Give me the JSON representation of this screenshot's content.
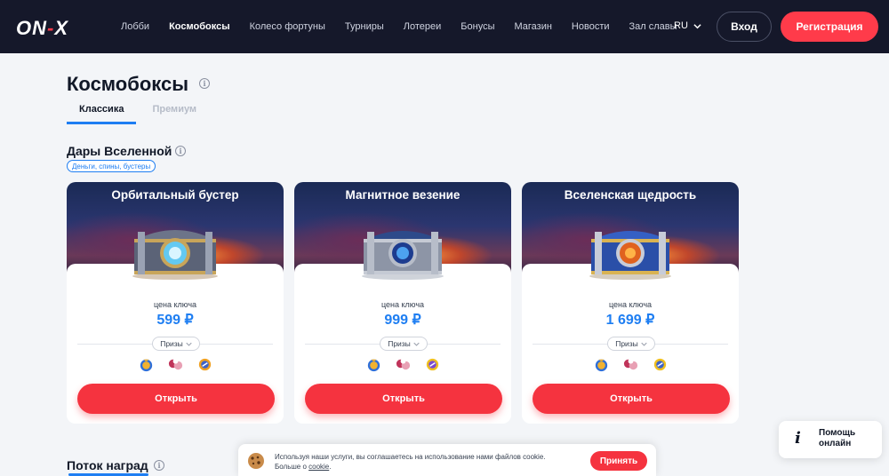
{
  "header": {
    "logo_main": "ON",
    "logo_dash": "-",
    "logo_x": "X",
    "nav": [
      "Лобби",
      "Космобоксы",
      "Колесо фортуны",
      "Турниры",
      "Лотереи",
      "Бонусы",
      "Магазин",
      "Новости",
      "Зал славы"
    ],
    "active_nav": "Космобоксы",
    "lang": "RU",
    "login_label": "Вход",
    "register_label": "Регистрация"
  },
  "page": {
    "title": "Космобоксы",
    "tabs": [
      {
        "label": "Классика",
        "active": true
      },
      {
        "label": "Премиум",
        "active": false
      }
    ]
  },
  "section": {
    "title": "Дары Вселенной",
    "badge": "Деньги, спины, бустеры"
  },
  "cards": [
    {
      "title": "Орбитальный бустер",
      "price_label": "цена ключа",
      "price": "599 ₽",
      "prizes_label": "Призы",
      "open_label": "Открыть",
      "chest_theme": "silver-glow"
    },
    {
      "title": "Магнитное везение",
      "price_label": "цена ключа",
      "price": "999 ₽",
      "prizes_label": "Призы",
      "open_label": "Открыть",
      "chest_theme": "steel-blue"
    },
    {
      "title": "Вселенская щедрость",
      "price_label": "цена ключа",
      "price": "1 699 ₽",
      "prizes_label": "Призы",
      "open_label": "Открыть",
      "chest_theme": "blue-vortex"
    }
  ],
  "next_section": {
    "title": "Поток наград"
  },
  "cookie": {
    "text": "Используя наши услуги, вы соглашаетесь на использование нами файлов cookie.",
    "more_prefix": "Больше о ",
    "link": "cookie",
    "more_suffix": ".",
    "accept_label": "Принять"
  },
  "help": {
    "label_line1": "Помощь",
    "label_line2": "онлайн"
  },
  "colors": {
    "header_bg": "#15182a",
    "accent_red": "#f5333f",
    "accent_blue": "#1e7ef2",
    "page_bg": "#f3f5f8"
  }
}
